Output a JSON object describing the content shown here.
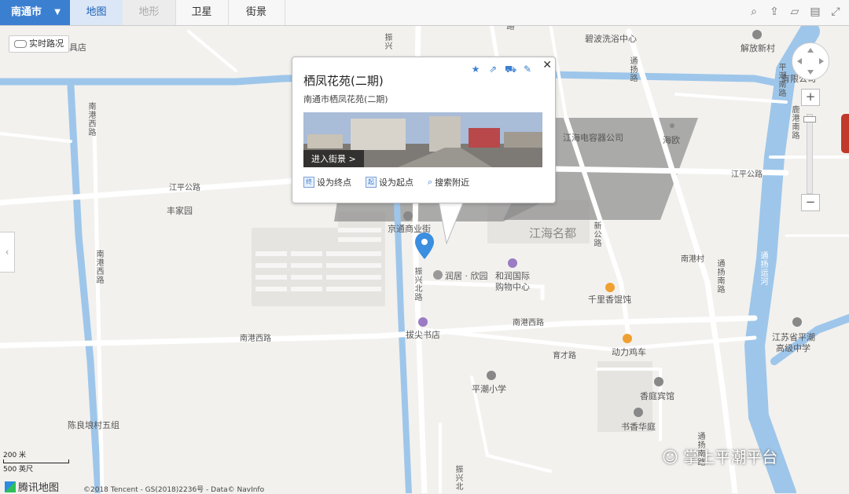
{
  "toolbar": {
    "city": "南通市",
    "tabs": [
      "地图",
      "地形",
      "卫星",
      "街景"
    ],
    "tool_icons": [
      "search-icon",
      "share-icon",
      "ruler-icon",
      "trash-icon",
      "fullscreen-icon"
    ]
  },
  "traffic_button": "实时路况",
  "popup": {
    "title": "栖凤花苑(二期)",
    "address": "南通市栖凤花苑(二期)",
    "street_button": "进入街景 >",
    "actions": {
      "set_end": "设为终点",
      "set_start": "设为起点",
      "search_nearby": "搜索附近"
    },
    "end_badge": "终",
    "start_badge": "起"
  },
  "map_labels": {
    "l1": "具店",
    "l2": "碧波洗浴中心",
    "l3": "解放新村",
    "l4": "有限公司",
    "l5": "江海电容器公司",
    "l6": "海欧",
    "l7": "江平公路",
    "l8": "江平公路",
    "l9": "丰家园",
    "l10": "京通商业街",
    "l11": "江海名都",
    "l12": "润居 · 欣园",
    "l13": "和润国际",
    "l14": "购物中心",
    "l15": "千里香馄饨",
    "l16": "南港西路",
    "l17": "南港西路",
    "l18": "拔尖书店",
    "l19": "育才路",
    "l20": "动力鸡车",
    "l21": "平潮小学",
    "l22": "香庭宾馆",
    "l23": "书香华庭",
    "l24": "陈良埌村五组",
    "l25": "南港村",
    "l26": "江苏省平潮",
    "l27": "高级中学",
    "v1": "振兴",
    "v2": "南港西路",
    "v3": "南港西路",
    "v4": "振兴北路",
    "v5": "新公路",
    "v6": "通扬南路",
    "v7": "通扬南路",
    "v8": "平潮南路",
    "v9": "鹿港南路",
    "v10": "振兴北",
    "v11": "通扬路",
    "v12": "通扬运河",
    "v13": "路"
  },
  "scale": {
    "top": "200 米",
    "bottom": "500 英尺"
  },
  "logo": "腾讯地图",
  "copyright": "©2018 Tencent - GS(2018)2236号 - Data© NavInfo",
  "watermark": "掌上平潮平台",
  "colors": {
    "accent": "#3b7fd1",
    "water": "#9ec6ea",
    "road": "#ffffff"
  }
}
